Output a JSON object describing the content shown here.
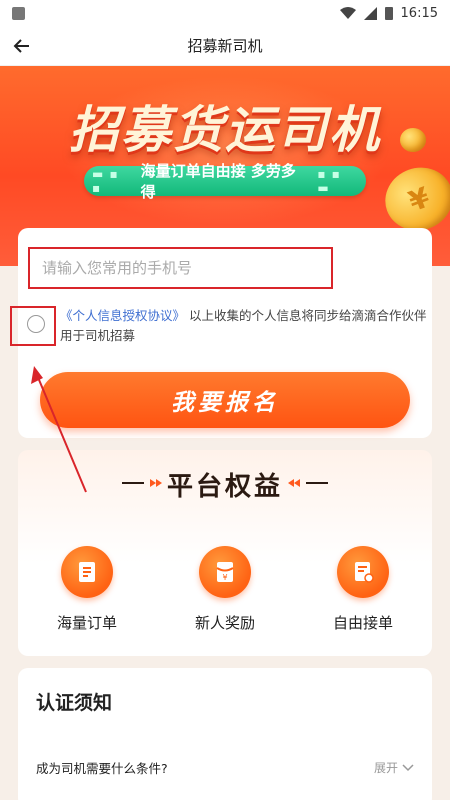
{
  "status_bar": {
    "time": "16:15"
  },
  "app_bar": {
    "title": "招募新司机"
  },
  "hero": {
    "title": "招募货运司机",
    "slogan": "海量订单自由接 多劳多得",
    "coin_symbol": "¥"
  },
  "register": {
    "phone_placeholder": "请输入您常用的手机号",
    "agreement_link": "《个人信息授权协议》",
    "agreement_text": "以上收集的个人信息将同步给滴滴合作伙伴用于司机招募",
    "signup_label": "我要报名"
  },
  "benefits": {
    "title": "平台权益",
    "items": [
      {
        "label": "海量订单",
        "icon": "order-list-icon"
      },
      {
        "label": "新人奖励",
        "icon": "red-envelope-icon"
      },
      {
        "label": "自由接单",
        "icon": "document-icon"
      }
    ]
  },
  "notice": {
    "title": "认证须知",
    "faq": [
      {
        "question": "成为司机需要什么条件?",
        "toggle": "展开"
      }
    ]
  },
  "colors": {
    "primary": "#ff5a1f",
    "annotation": "#d9252a",
    "link": "#3f6fd1",
    "slogan_green": "#12b87a"
  }
}
